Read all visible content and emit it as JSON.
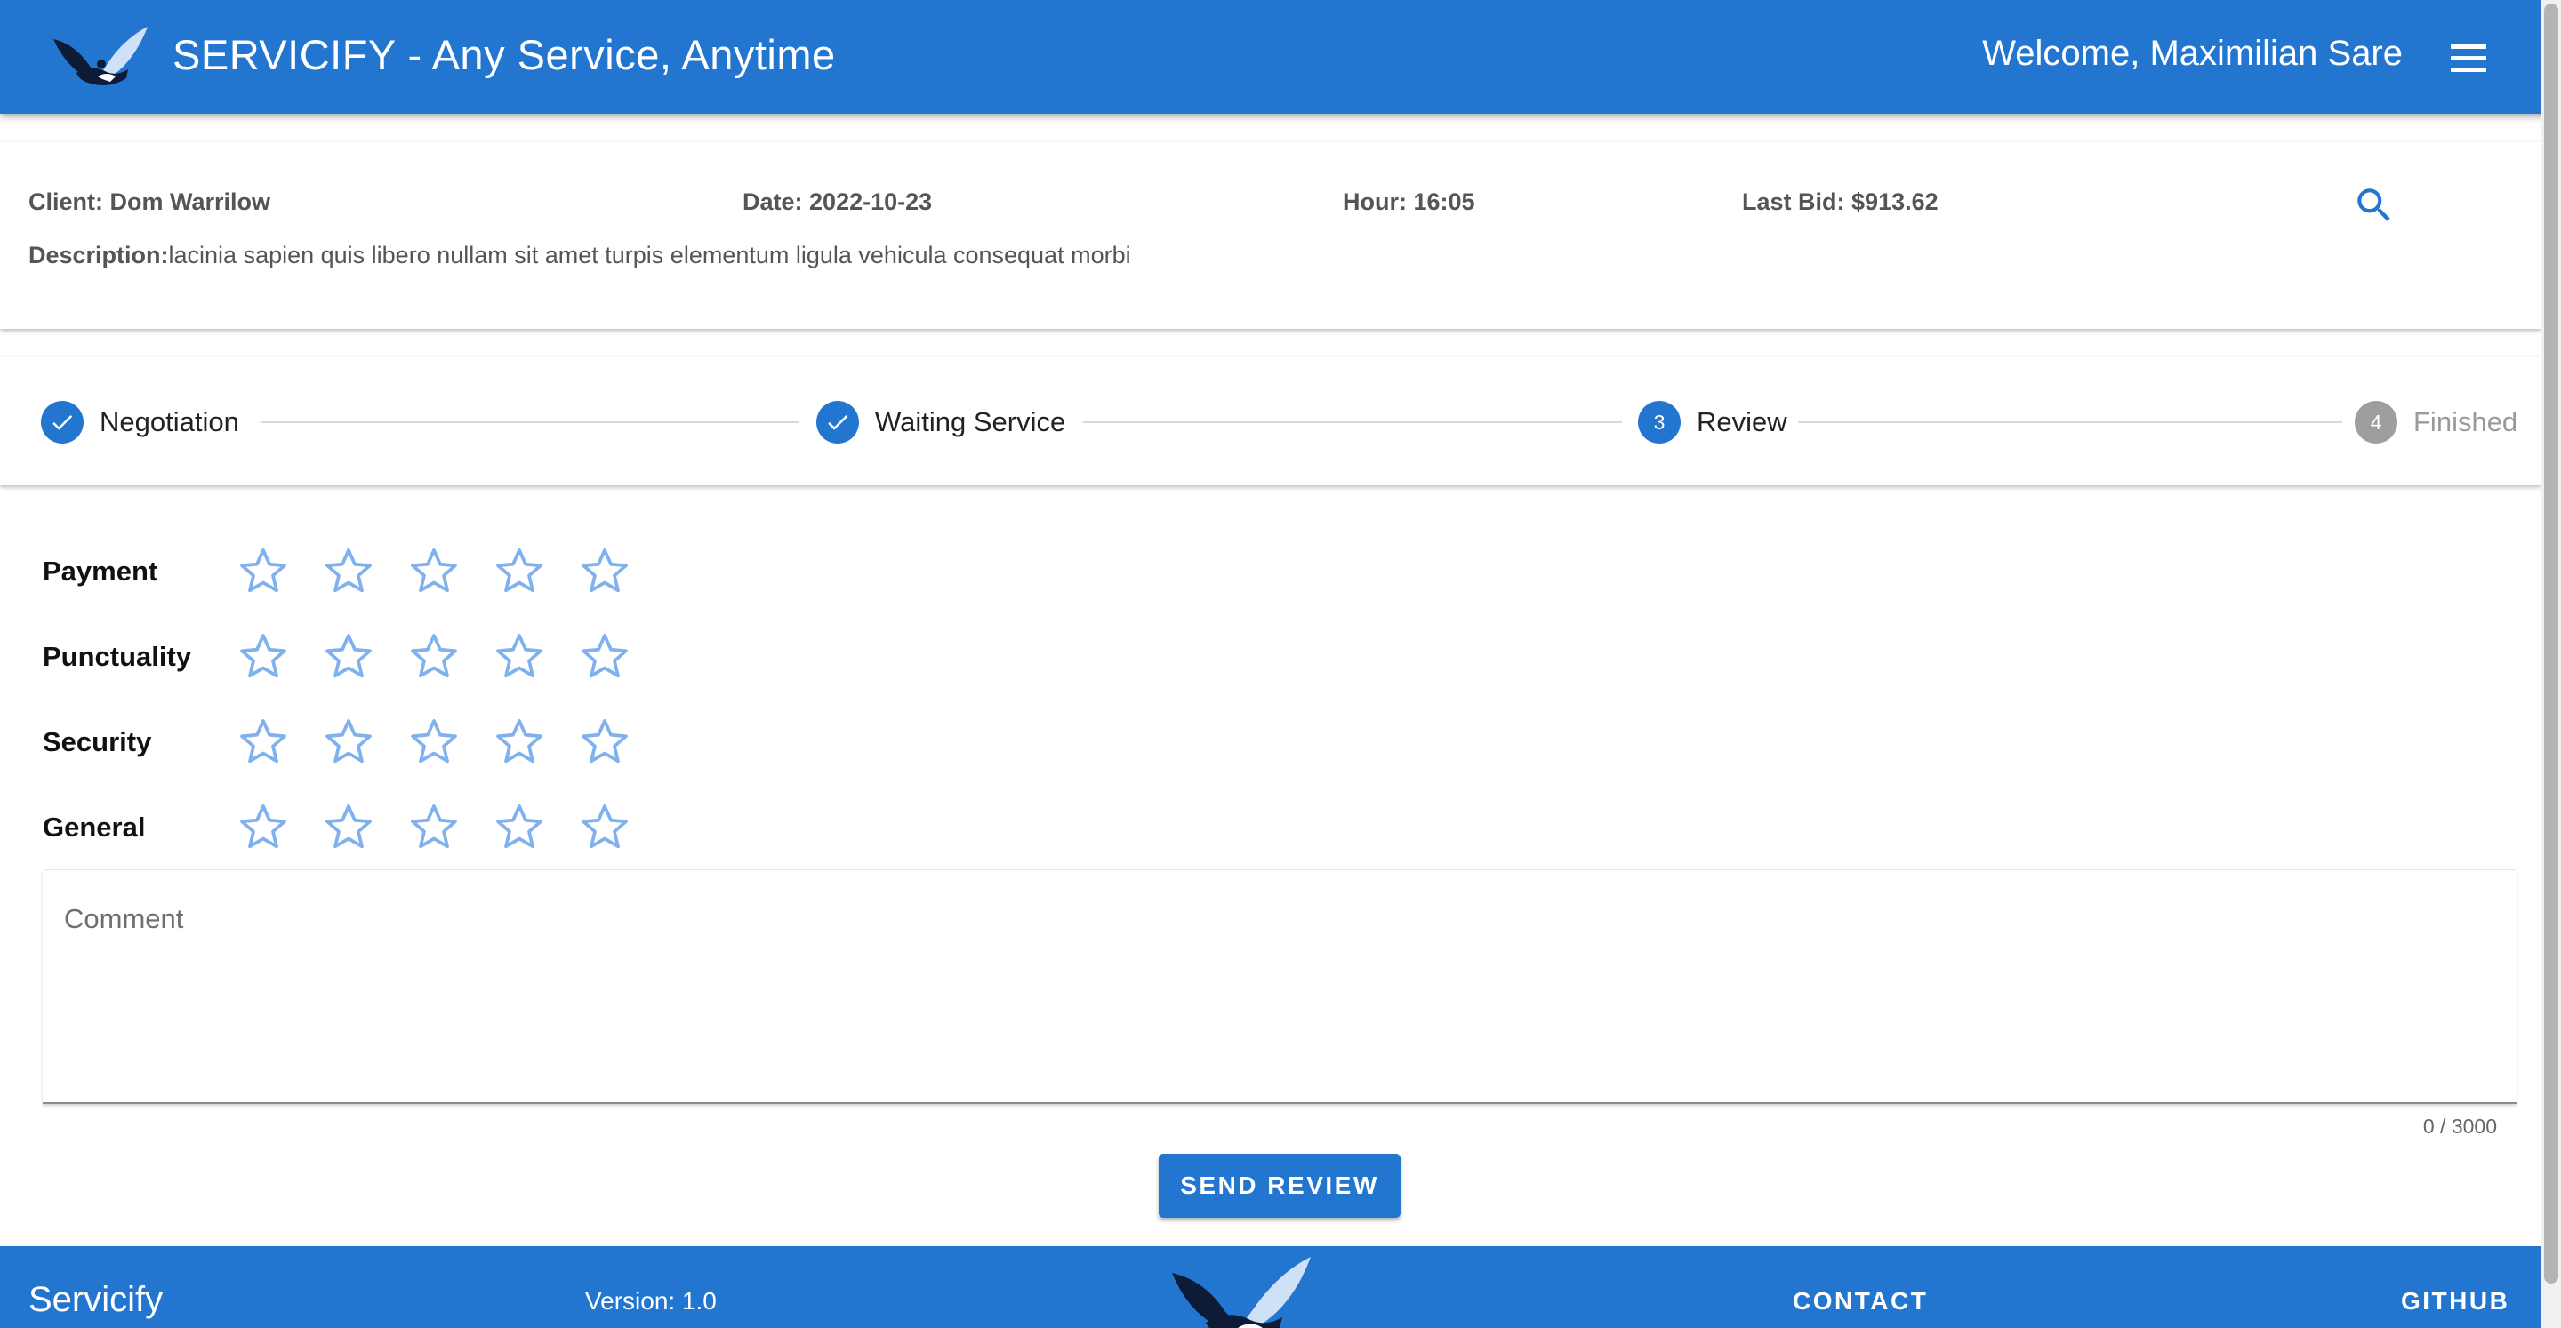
{
  "header": {
    "title": "SERVICIFY - Any Service, Anytime",
    "welcome": "Welcome, Maximilian Sare",
    "logo_icon": "eagle-handshake-icon",
    "menu_icon": "hamburger-menu-icon"
  },
  "info": {
    "client_label": "Client:",
    "client_value": "Dom Warrilow",
    "date_label": "Date:",
    "date_value": "2022-10-23",
    "hour_label": "Hour:",
    "hour_value": "16:05",
    "bid_label": "Last Bid:",
    "bid_value": "$913.62",
    "description_label": "Description:",
    "description_value": "lacinia sapien quis libero nullam sit amet turpis elementum ligula vehicula consequat morbi",
    "search_icon": "search-icon"
  },
  "stepper": {
    "steps": [
      {
        "label": "Negotiation",
        "state": "completed"
      },
      {
        "label": "Waiting Service",
        "state": "completed"
      },
      {
        "label": "Review",
        "number": "3",
        "state": "active"
      },
      {
        "label": "Finished",
        "number": "4",
        "state": "inactive"
      }
    ]
  },
  "ratings": {
    "categories": [
      {
        "label": "Payment",
        "value": 0,
        "max": 5
      },
      {
        "label": "Punctuality",
        "value": 0,
        "max": 5
      },
      {
        "label": "Security",
        "value": 0,
        "max": 5
      },
      {
        "label": "General",
        "value": 0,
        "max": 5
      }
    ]
  },
  "comment": {
    "placeholder": "Comment",
    "value": "",
    "counter": "0 / 3000"
  },
  "actions": {
    "send_label": "SEND REVIEW"
  },
  "footer": {
    "brand": "Servicify",
    "version": "Version: 1.0",
    "contact": "CONTACT",
    "github": "GITHUB"
  },
  "colors": {
    "primary": "#2376d0",
    "star_outline": "#7fb1ee",
    "inactive_step": "#9e9e9e"
  }
}
